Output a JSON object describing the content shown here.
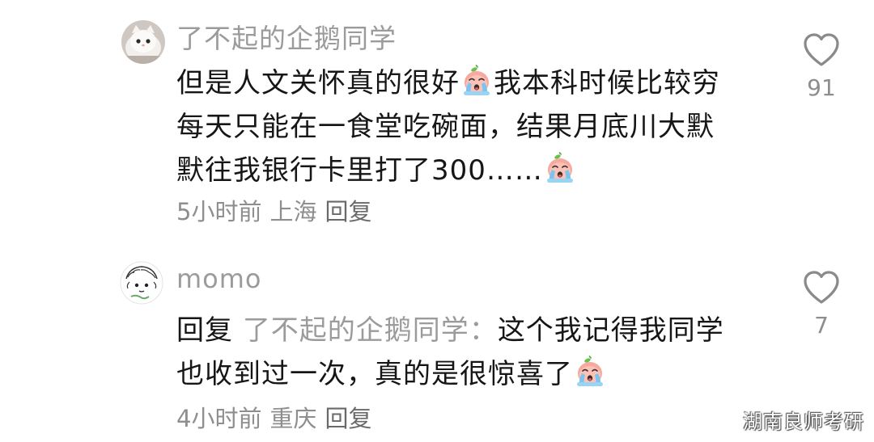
{
  "comments": [
    {
      "username": "了不起的企鹅同学",
      "avatar_icon": "cat-avatar",
      "body_lines": [
        {
          "text_before": "但是人文关怀真的很好",
          "emoji": "crying-peach-emoji",
          "text_after": "我本科时候比较穷"
        },
        {
          "text_before": "每天只能在一食堂吃碗面，结果月底川大默"
        },
        {
          "text_before": "默往我银行卡里打了300……",
          "emoji": "crying-peach-emoji"
        }
      ],
      "time": "5小时前",
      "location": "上海",
      "reply_label": "回复",
      "like_icon": "heart-outline-icon",
      "like_count": "91"
    },
    {
      "username": "momo",
      "avatar_icon": "sketch-avatar",
      "reply_prefix": "回复",
      "reply_target": "了不起的企鹅同学",
      "reply_sep": "：",
      "body_lines": [
        {
          "text_before": "这个我记得我同学"
        },
        {
          "text_before": "也收到过一次，真的是很惊喜了",
          "emoji": "crying-peach-emoji"
        }
      ],
      "time": "4小时前",
      "location": "重庆",
      "reply_label": "回复",
      "like_icon": "heart-outline-icon",
      "like_count": "7"
    }
  ],
  "watermark": "湖南良师考研",
  "colors": {
    "text": "#161616",
    "muted": "#9b9b9b",
    "meta": "#8e8e8e",
    "background": "#ffffff"
  }
}
